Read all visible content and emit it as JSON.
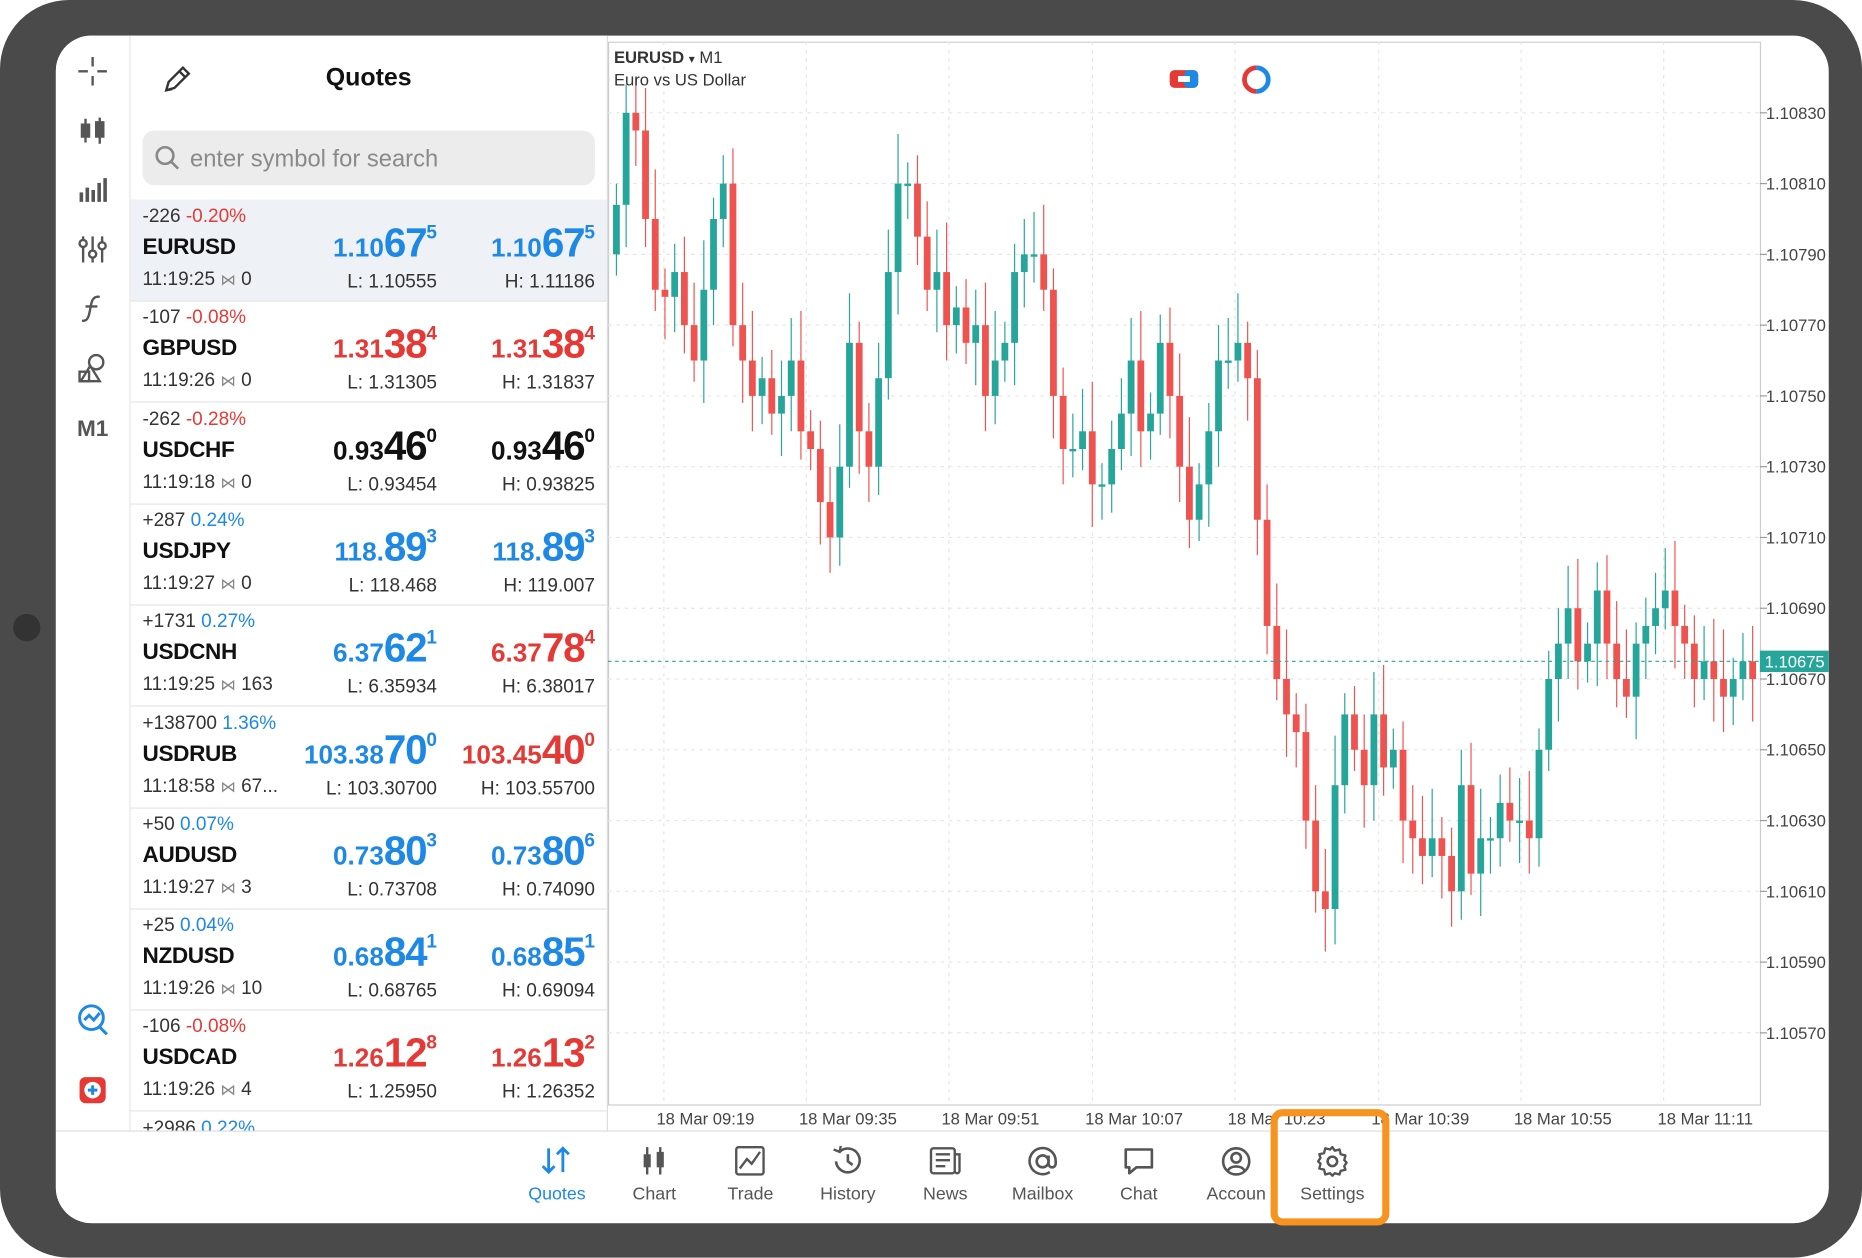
{
  "toolbar": {
    "items": [
      "crosshair-icon",
      "chart-type-icon",
      "indicators-icon",
      "settings-sliders-icon",
      "function-icon",
      "objects-icon"
    ],
    "timeframe": "M1",
    "bottom_items": [
      "trade-signals-icon",
      "app-icon"
    ]
  },
  "quotes": {
    "title": "Quotes",
    "search_placeholder": "enter symbol for search",
    "rows": [
      {
        "change": "-226",
        "pct": "-0.20%",
        "pct_dir": "neg",
        "symbol": "EURUSD",
        "time": "11:19:25",
        "spread": "0",
        "bid_pre": "1.10",
        "bid_big": "67",
        "bid_sup": "5",
        "bid_color": "blue",
        "ask_pre": "1.10",
        "ask_big": "67",
        "ask_sup": "5",
        "ask_color": "blue",
        "low": "L: 1.10555",
        "high": "H: 1.11186",
        "selected": true
      },
      {
        "change": "-107",
        "pct": "-0.08%",
        "pct_dir": "neg",
        "symbol": "GBPUSD",
        "time": "11:19:26",
        "spread": "0",
        "bid_pre": "1.31",
        "bid_big": "38",
        "bid_sup": "4",
        "bid_color": "red",
        "ask_pre": "1.31",
        "ask_big": "38",
        "ask_sup": "4",
        "ask_color": "red",
        "low": "L: 1.31305",
        "high": "H: 1.31837"
      },
      {
        "change": "-262",
        "pct": "-0.28%",
        "pct_dir": "neg",
        "symbol": "USDCHF",
        "time": "11:19:18",
        "spread": "0",
        "bid_pre": "0.93",
        "bid_big": "46",
        "bid_sup": "0",
        "bid_color": "black",
        "ask_pre": "0.93",
        "ask_big": "46",
        "ask_sup": "0",
        "ask_color": "black",
        "low": "L: 0.93454",
        "high": "H: 0.93825"
      },
      {
        "change": "+287",
        "pct": "0.24%",
        "pct_dir": "pos",
        "symbol": "USDJPY",
        "time": "11:19:27",
        "spread": "0",
        "bid_pre": "118.",
        "bid_big": "89",
        "bid_sup": "3",
        "bid_color": "blue",
        "ask_pre": "118.",
        "ask_big": "89",
        "ask_sup": "3",
        "ask_color": "blue",
        "low": "L: 118.468",
        "high": "H: 119.007"
      },
      {
        "change": "+1731",
        "pct": "0.27%",
        "pct_dir": "pos",
        "symbol": "USDCNH",
        "time": "11:19:25",
        "spread": "163",
        "bid_pre": "6.37",
        "bid_big": "62",
        "bid_sup": "1",
        "bid_color": "blue",
        "ask_pre": "6.37",
        "ask_big": "78",
        "ask_sup": "4",
        "ask_color": "red",
        "low": "L: 6.35934",
        "high": "H: 6.38017"
      },
      {
        "change": "+138700",
        "pct": "1.36%",
        "pct_dir": "pos",
        "symbol": "USDRUB",
        "time": "11:18:58",
        "spread": "67...",
        "bid_pre": "103.38",
        "bid_big": "70",
        "bid_sup": "0",
        "bid_color": "blue",
        "ask_pre": "103.45",
        "ask_big": "40",
        "ask_sup": "0",
        "ask_color": "red",
        "low": "L: 103.30700",
        "high": "H: 103.55700"
      },
      {
        "change": "+50",
        "pct": "0.07%",
        "pct_dir": "pos",
        "symbol": "AUDUSD",
        "time": "11:19:27",
        "spread": "3",
        "bid_pre": "0.73",
        "bid_big": "80",
        "bid_sup": "3",
        "bid_color": "blue",
        "ask_pre": "0.73",
        "ask_big": "80",
        "ask_sup": "6",
        "ask_color": "blue",
        "low": "L: 0.73708",
        "high": "H: 0.74090"
      },
      {
        "change": "+25",
        "pct": "0.04%",
        "pct_dir": "pos",
        "symbol": "NZDUSD",
        "time": "11:19:26",
        "spread": "10",
        "bid_pre": "0.68",
        "bid_big": "84",
        "bid_sup": "1",
        "bid_color": "blue",
        "ask_pre": "0.68",
        "ask_big": "85",
        "ask_sup": "1",
        "ask_color": "blue",
        "low": "L: 0.68765",
        "high": "H: 0.69094"
      },
      {
        "change": "-106",
        "pct": "-0.08%",
        "pct_dir": "neg",
        "symbol": "USDCAD",
        "time": "11:19:26",
        "spread": "4",
        "bid_pre": "1.26",
        "bid_big": "12",
        "bid_sup": "8",
        "bid_color": "red",
        "ask_pre": "1.26",
        "ask_big": "13",
        "ask_sup": "2",
        "ask_color": "red",
        "low": "L: 1.25950",
        "high": "H: 1.26352"
      },
      {
        "change": "+2986",
        "pct": "0.22%",
        "pct_dir": "pos",
        "symbol": "",
        "time": "",
        "spread": "",
        "bid_pre": "",
        "bid_big": "",
        "bid_sup": "",
        "bid_color": "blue",
        "ask_pre": "",
        "ask_big": "",
        "ask_sup": "",
        "ask_color": "blue",
        "low": "",
        "high": ""
      }
    ]
  },
  "chart": {
    "symbol": "EURUSD",
    "timeframe": "M1",
    "description": "Euro vs US Dollar",
    "current_price": "1.10675",
    "colors": {
      "bull": "#26a69a",
      "bear": "#ef5350",
      "grid": "#e6e6e6",
      "price_line": "#26a69a"
    }
  },
  "chart_data": {
    "type": "candlestick",
    "y_ticks": [
      "1.10830",
      "1.10810",
      "1.10790",
      "1.10770",
      "1.10750",
      "1.10730",
      "1.10710",
      "1.10690",
      "1.10670",
      "1.10650",
      "1.10630",
      "1.10610",
      "1.10590",
      "1.10570"
    ],
    "x_ticks": [
      "18 Mar 09:19",
      "18 Mar 09:35",
      "18 Mar 09:51",
      "18 Mar 10:07",
      "18 Mar 10:23",
      "18 Mar 10:39",
      "18 Mar 10:55",
      "18 Mar 11:11"
    ],
    "ylim": [
      1.10555,
      1.10845
    ],
    "close": [
      1.10804,
      1.1083,
      1.10825,
      1.108,
      1.1078,
      1.10778,
      1.10785,
      1.1077,
      1.1076,
      1.1078,
      1.108,
      1.1081,
      1.1077,
      1.1076,
      1.1075,
      1.10755,
      1.10745,
      1.1075,
      1.1076,
      1.1074,
      1.10735,
      1.1072,
      1.1071,
      1.1073,
      1.10765,
      1.1074,
      1.1073,
      1.10755,
      1.10785,
      1.1081,
      1.1081,
      1.10795,
      1.1078,
      1.10785,
      1.1077,
      1.10775,
      1.10765,
      1.1077,
      1.1075,
      1.1076,
      1.10765,
      1.10785,
      1.1079,
      1.1079,
      1.1078,
      1.1075,
      1.10735,
      1.10735,
      1.1074,
      1.10725,
      1.10725,
      1.10735,
      1.10745,
      1.1076,
      1.1074,
      1.10745,
      1.10765,
      1.1075,
      1.1073,
      1.10715,
      1.10725,
      1.1074,
      1.1076,
      1.1076,
      1.10765,
      1.10755,
      1.10715,
      1.10685,
      1.1067,
      1.1066,
      1.10655,
      1.1063,
      1.1061,
      1.10605,
      1.1064,
      1.1066,
      1.1065,
      1.1064,
      1.1066,
      1.10645,
      1.1065,
      1.1063,
      1.10625,
      1.1062,
      1.10625,
      1.1062,
      1.1061,
      1.1064,
      1.10615,
      1.10625,
      1.10625,
      1.10635,
      1.1063,
      1.1063,
      1.10625,
      1.1065,
      1.1067,
      1.1068,
      1.1069,
      1.10675,
      1.1068,
      1.10695,
      1.1068,
      1.1067,
      1.10665,
      1.1068,
      1.10685,
      1.1069,
      1.10695,
      1.10685,
      1.1068,
      1.1067,
      1.10675,
      1.1067,
      1.10665,
      1.1067,
      1.10675,
      1.1067
    ],
    "open": [
      1.1079,
      1.10804,
      1.1083,
      1.10825,
      1.108,
      1.1078,
      1.10778,
      1.10785,
      1.1077,
      1.1076,
      1.1078,
      1.108,
      1.1081,
      1.1077,
      1.1076,
      1.1075,
      1.10755,
      1.10745,
      1.1075,
      1.1076,
      1.1074,
      1.10735,
      1.1072,
      1.1071,
      1.1073,
      1.10765,
      1.1074,
      1.1073,
      1.10755,
      1.10785,
      1.1081,
      1.1081,
      1.10795,
      1.1078,
      1.10785,
      1.1077,
      1.10775,
      1.10765,
      1.1077,
      1.1075,
      1.1076,
      1.10765,
      1.10785,
      1.1079,
      1.1079,
      1.1078,
      1.1075,
      1.10735,
      1.10735,
      1.1074,
      1.10725,
      1.10725,
      1.10735,
      1.10745,
      1.1076,
      1.1074,
      1.10745,
      1.10765,
      1.1075,
      1.1073,
      1.10715,
      1.10725,
      1.1074,
      1.1076,
      1.1076,
      1.10765,
      1.10755,
      1.10715,
      1.10685,
      1.1067,
      1.1066,
      1.10655,
      1.1063,
      1.1061,
      1.10605,
      1.1064,
      1.1066,
      1.1065,
      1.1064,
      1.1066,
      1.10645,
      1.1065,
      1.1063,
      1.10625,
      1.1062,
      1.10625,
      1.1062,
      1.1061,
      1.1064,
      1.10615,
      1.10625,
      1.10625,
      1.10635,
      1.1063,
      1.1063,
      1.10625,
      1.1065,
      1.1067,
      1.1068,
      1.1069,
      1.10675,
      1.1068,
      1.10695,
      1.1068,
      1.1067,
      1.10665,
      1.1068,
      1.10685,
      1.1069,
      1.10695,
      1.10685,
      1.1068,
      1.1067,
      1.10675,
      1.1067,
      1.10665,
      1.1067,
      1.10675
    ]
  },
  "bottom_nav": {
    "items": [
      {
        "label": "Quotes",
        "icon": "quotes-icon",
        "active": true
      },
      {
        "label": "Chart",
        "icon": "chart-icon"
      },
      {
        "label": "Trade",
        "icon": "trade-icon"
      },
      {
        "label": "History",
        "icon": "history-icon"
      },
      {
        "label": "News",
        "icon": "news-icon"
      },
      {
        "label": "Mailbox",
        "icon": "mailbox-icon"
      },
      {
        "label": "Chat",
        "icon": "chat-icon"
      },
      {
        "label": "Accoun",
        "icon": "account-icon"
      },
      {
        "label": "Settings",
        "icon": "settings-icon",
        "highlighted": true
      }
    ]
  },
  "highlight_color": "#f7931e"
}
